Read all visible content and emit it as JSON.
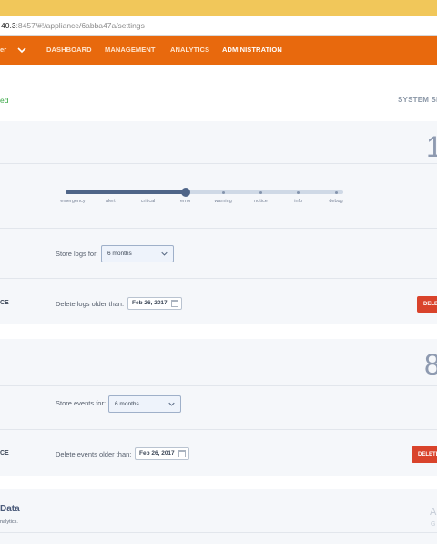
{
  "browser": {
    "url_host": "40.3",
    "url_rest": ":8457/#!/appliance/6abba47a/settings"
  },
  "nav": {
    "left_label": "er",
    "items": [
      {
        "label": "DASHBOARD",
        "active": false
      },
      {
        "label": "MANAGEMENT",
        "active": false
      },
      {
        "label": "ANALYTICS",
        "active": false
      },
      {
        "label": "ADMINISTRATION",
        "active": true
      }
    ],
    "accent_color": "#e8690d"
  },
  "subheader": {
    "left_text": "ed",
    "right_text": "SYSTEM SE"
  },
  "log_section": {
    "count_text": "1",
    "levels": [
      "emergency",
      "alert",
      "critical",
      "error",
      "warning",
      "notice",
      "info",
      "debug"
    ],
    "selected_level": "error",
    "store_label": "Store logs for:",
    "store_value": "6 months",
    "cutoff_label": "CE",
    "delete_label": "Delete logs older than:",
    "delete_date": "Feb 26, 2017",
    "delete_button": "DELETE"
  },
  "event_section": {
    "count_text": "8",
    "store_label": "Store events for:",
    "store_value": "6 months",
    "cutoff_label": "CE",
    "delete_label": "Delete events older than:",
    "delete_date": "Feb 26, 2017",
    "delete_button": "DELETE"
  },
  "data_section": {
    "title": "Data",
    "subtitle": "nalytics.",
    "right_a": "A",
    "right_b": "G"
  }
}
